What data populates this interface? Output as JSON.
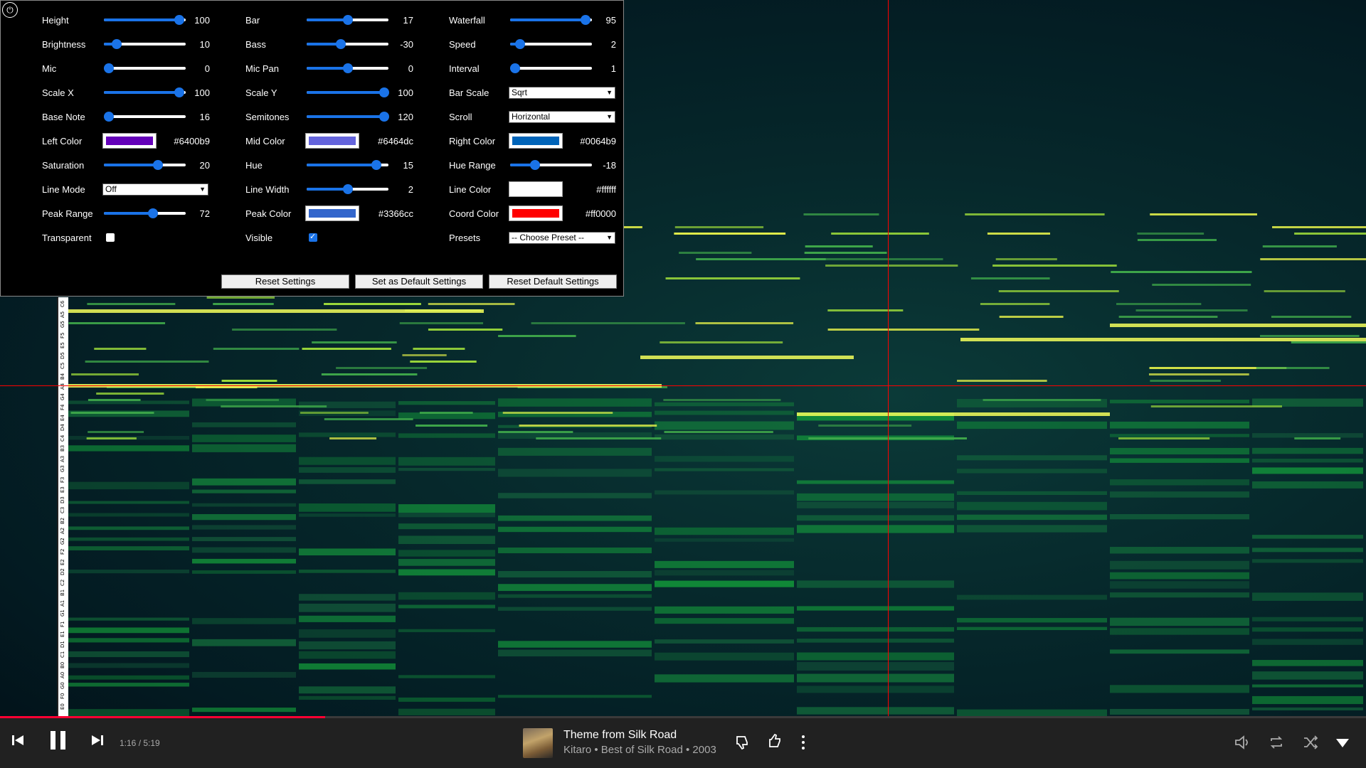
{
  "panel": {
    "columns": [
      [
        {
          "label": "Height",
          "type": "slider",
          "value": "100",
          "fraction": 0.92
        },
        {
          "label": "Brightness",
          "type": "slider",
          "value": "10",
          "fraction": 0.16
        },
        {
          "label": "Mic",
          "type": "slider",
          "value": "0",
          "fraction": 0.06
        },
        {
          "label": "Scale X",
          "type": "slider",
          "value": "100",
          "fraction": 0.92
        },
        {
          "label": "Base Note",
          "type": "slider",
          "value": "16",
          "fraction": 0.06
        },
        {
          "label": "Left Color",
          "type": "color",
          "value": "#6400b9",
          "color": "#6400b9"
        },
        {
          "label": "Saturation",
          "type": "slider",
          "value": "20",
          "fraction": 0.66
        },
        {
          "label": "Line Mode",
          "type": "select",
          "value": "Off"
        },
        {
          "label": "Peak Range",
          "type": "slider",
          "value": "72",
          "fraction": 0.6
        },
        {
          "label": "Transparent",
          "type": "checkbox",
          "checked": false
        }
      ],
      [
        {
          "label": "Bar",
          "type": "slider",
          "value": "17",
          "fraction": 0.5
        },
        {
          "label": "Bass",
          "type": "slider",
          "value": "-30",
          "fraction": 0.42
        },
        {
          "label": "Mic Pan",
          "type": "slider",
          "value": "0",
          "fraction": 0.5
        },
        {
          "label": "Scale Y",
          "type": "slider",
          "value": "100",
          "fraction": 0.95
        },
        {
          "label": "Semitones",
          "type": "slider",
          "value": "120",
          "fraction": 0.95
        },
        {
          "label": "Mid Color",
          "type": "color",
          "value": "#6464dc",
          "color": "#6464dc"
        },
        {
          "label": "Hue",
          "type": "slider",
          "value": "15",
          "fraction": 0.85
        },
        {
          "label": "Line Width",
          "type": "slider",
          "value": "2",
          "fraction": 0.5
        },
        {
          "label": "Peak Color",
          "type": "color",
          "value": "#3366cc",
          "color": "#3366cc"
        },
        {
          "label": "Visible",
          "type": "checkbox",
          "checked": true
        }
      ],
      [
        {
          "label": "Waterfall",
          "type": "slider",
          "value": "95",
          "fraction": 0.92
        },
        {
          "label": "Speed",
          "type": "slider",
          "value": "2",
          "fraction": 0.12
        },
        {
          "label": "Interval",
          "type": "slider",
          "value": "1",
          "fraction": 0.06
        },
        {
          "label": "Bar Scale",
          "type": "select",
          "value": "Sqrt"
        },
        {
          "label": "Scroll",
          "type": "select",
          "value": "Horizontal"
        },
        {
          "label": "Right Color",
          "type": "color",
          "value": "#0064b9",
          "color": "#0064b9"
        },
        {
          "label": "Hue Range",
          "type": "slider",
          "value": "-18",
          "fraction": 0.3
        },
        {
          "label": "Line Color",
          "type": "color",
          "value": "#ffffff",
          "color": "#ffffff"
        },
        {
          "label": "Coord Color",
          "type": "color",
          "value": "#ff0000",
          "color": "#ff0000"
        },
        {
          "label": "Presets",
          "type": "select",
          "value": "-- Choose Preset --"
        }
      ]
    ],
    "buttons": {
      "reset": "Reset Settings",
      "set_default": "Set as Default Settings",
      "reset_default": "Reset Default Settings"
    }
  },
  "keyboard_labels": [
    "C6",
    "A5",
    "G5",
    "F5",
    "E5",
    "D5",
    "C5",
    "B4",
    "A4",
    "G4",
    "F4",
    "E4",
    "D4",
    "C4",
    "B3",
    "A3",
    "G3",
    "F3",
    "E3",
    "D3",
    "C3",
    "B2",
    "A2",
    "G2",
    "F2",
    "E2",
    "D2",
    "C2",
    "B1",
    "A1",
    "G1",
    "F1",
    "E1",
    "D1",
    "C1",
    "B0",
    "A0",
    "G0",
    "F0",
    "E0"
  ],
  "player": {
    "time": "1:16 / 5:19",
    "progress": 0.238,
    "title": "Theme from Silk Road",
    "subtitle": "Kitaro • Best of Silk Road • 2003"
  },
  "colors": {
    "accent": "#1a73e8",
    "progress": "#ff0033",
    "coord": "#ff0000"
  },
  "icons": [
    "previous-icon",
    "pause-icon",
    "next-icon",
    "dislike-icon",
    "like-icon",
    "more-icon",
    "volume-icon",
    "repeat-icon",
    "shuffle-icon",
    "expand-icon"
  ]
}
